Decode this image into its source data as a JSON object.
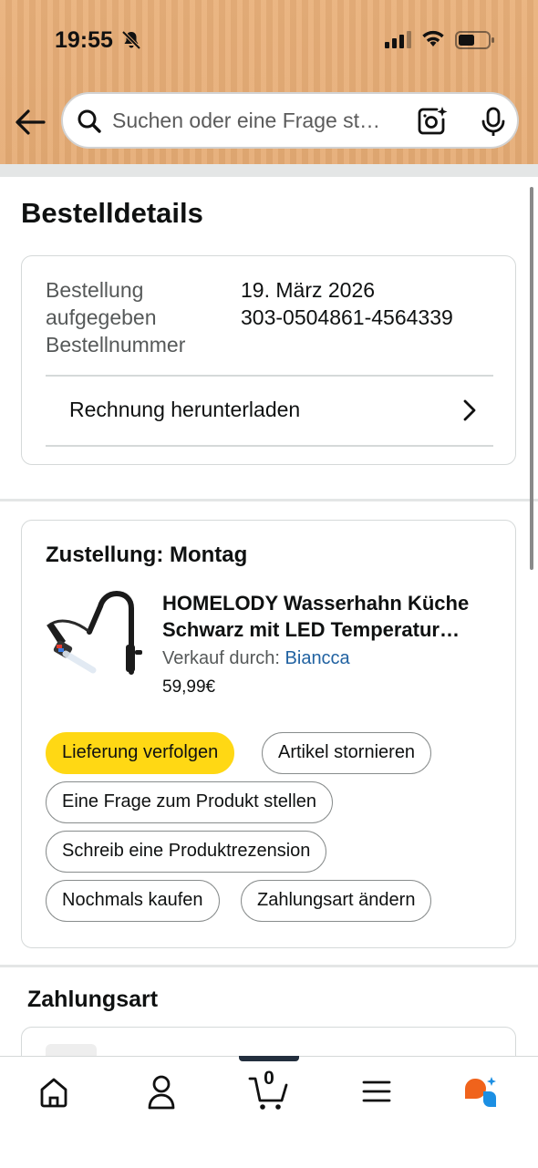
{
  "status_bar": {
    "time": "19:55",
    "icons": [
      "bell-muted-icon",
      "signal-icon",
      "wifi-icon",
      "battery-icon"
    ]
  },
  "search": {
    "placeholder": "Suchen oder eine Frage st…",
    "icons": [
      "back-arrow-icon",
      "search-icon",
      "camera-icon",
      "mic-icon"
    ]
  },
  "page": {
    "title": "Bestelldetails"
  },
  "order": {
    "placed_label_line1": "Bestellung",
    "placed_label_line2": "aufgegeben",
    "number_label": "Bestellnummer",
    "date": "19. März 2026",
    "number": "303-0504861-4564339",
    "invoice_label": "Rechnung herunterladen"
  },
  "delivery": {
    "title": "Zustellung: Montag",
    "product": {
      "title_line1": "HOMELODY Wasserhahn Küche",
      "title_line2": "Schwarz mit LED Temperatur…",
      "seller_prefix": "Verkauf durch:",
      "seller": "Biancca",
      "price": "59,99€"
    },
    "actions": {
      "track": "Lieferung verfolgen",
      "cancel": "Artikel stornieren",
      "question": "Eine Frage zum Produkt stellen",
      "review": "Schreib eine Produktrezension",
      "buy_again": "Nochmals kaufen",
      "change_payment": "Zahlungsart ändern"
    }
  },
  "payment": {
    "title": "Zahlungsart"
  },
  "bottom_nav": {
    "items": [
      "home-icon",
      "account-icon",
      "cart-icon",
      "menu-icon",
      "rufus-icon"
    ],
    "cart_count": "0"
  },
  "colors": {
    "header_bg": "#e7ad77",
    "primary_button": "#ffd814",
    "link": "#2162a1",
    "muted_text": "#565959",
    "border": "#d5d9d9"
  }
}
